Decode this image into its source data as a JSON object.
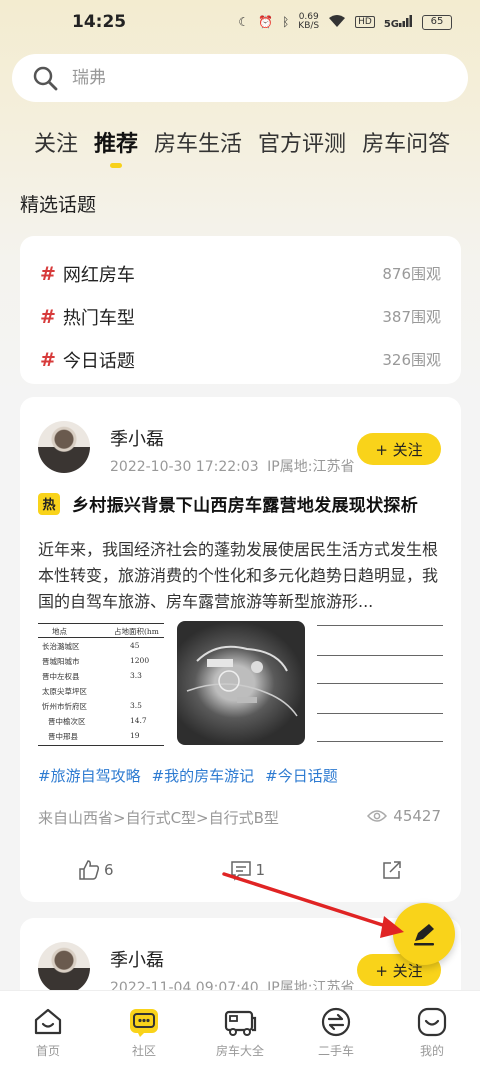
{
  "status_bar": {
    "time": "14:25",
    "net_speed_value": "0.69",
    "net_speed_unit": "KB/S",
    "hd_label": "HD",
    "signal_label": "5G",
    "battery": "65"
  },
  "search": {
    "placeholder": "瑞弗"
  },
  "tabs": [
    {
      "label": "关注"
    },
    {
      "label": "推荐",
      "active": true
    },
    {
      "label": "房车生活"
    },
    {
      "label": "官方评测"
    },
    {
      "label": "房车问答"
    }
  ],
  "featured_topics": {
    "title": "精选话题",
    "items": [
      {
        "hash": "#",
        "name": "网红房车",
        "count": "876围观"
      },
      {
        "hash": "#",
        "name": "热门车型",
        "count": "387围观"
      },
      {
        "hash": "#",
        "name": "今日话题",
        "count": "326围观"
      }
    ]
  },
  "post": {
    "author": "季小磊",
    "time": "2022-10-30 17:22:03",
    "ip": "IP属地:江苏省",
    "follow_label": "+ 关注",
    "hot_badge": "热",
    "title": "乡村振兴背景下山西房车露营地发展现状探析",
    "body": "近年来，我国经济社会的蓬勃发展使居民生活方式发生根本性转变，旅游消费的个性化和多元化趋势日趋明显，我国的自驾车旅游、房车露营旅游等新型旅游形...",
    "table_image": {
      "headers": [
        "地点",
        "占地面积(hm"
      ],
      "rows": [
        [
          "长治潞城区",
          "45"
        ],
        [
          "晋城阳城市",
          "1200"
        ],
        [
          "晋中左权县",
          "3.3"
        ],
        [
          "太原尖草坪区",
          ""
        ],
        [
          "忻州市忻府区",
          "3.5"
        ],
        [
          "晋中榆次区",
          "14.7"
        ],
        [
          "晋中邢县",
          "19"
        ]
      ]
    },
    "hashtags": [
      "#旅游自驾攻略",
      "#我的房车游记",
      "#今日话题"
    ],
    "source": "来自山西省>自行式C型>自行式B型",
    "views": "45427",
    "likes": "6",
    "comments": "1"
  },
  "post2": {
    "author": "季小磊",
    "time": "2022-11-04 09:07:40",
    "ip": "IP属地:江苏省",
    "follow_label": "+ 关注"
  },
  "bottom_nav": [
    {
      "label": "首页",
      "icon": "home-icon"
    },
    {
      "label": "社区",
      "icon": "community-icon",
      "active": true
    },
    {
      "label": "房车大全",
      "icon": "rv-icon"
    },
    {
      "label": "二手车",
      "icon": "exchange-icon"
    },
    {
      "label": "我的",
      "icon": "profile-icon"
    }
  ],
  "colors": {
    "accent": "#f9d31a",
    "hashtag": "#2e7bd1",
    "hash_red": "#d73b3b",
    "annotation_arrow": "#e02424"
  }
}
